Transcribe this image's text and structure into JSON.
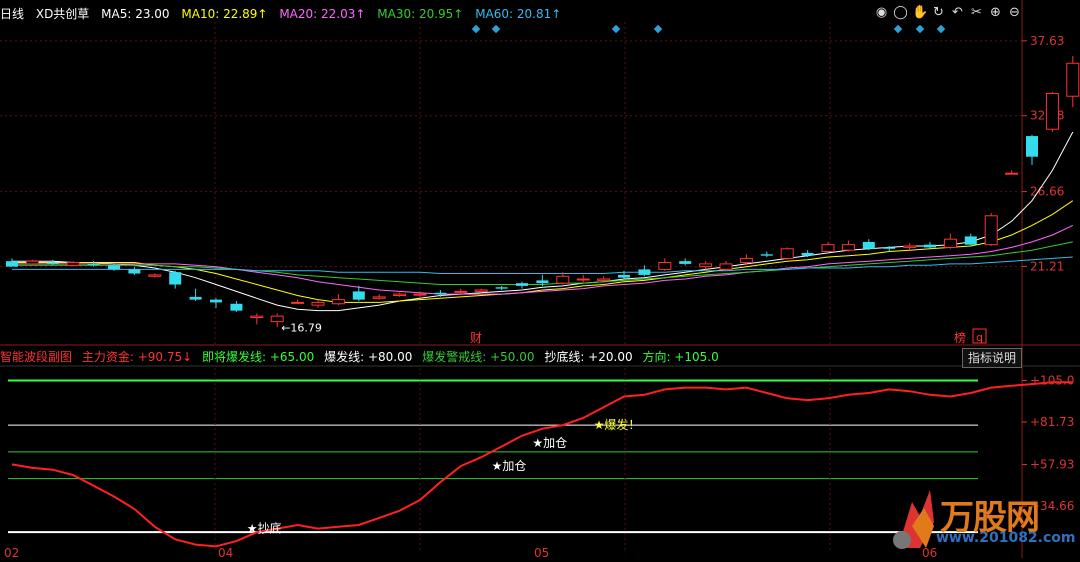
{
  "header": {
    "period": "日线",
    "stock_name": "XD共创草",
    "ma5": "MA5: 23.00",
    "ma10": "MA10: 22.89↑",
    "ma20": "MA20: 22.03↑",
    "ma30": "MA30: 20.95↑",
    "ma60": "MA60: 20.81↑",
    "colors": {
      "ma5": "#ffffff",
      "ma10": "#ffff00",
      "ma20": "#ff66ff",
      "ma30": "#33cc33",
      "ma60": "#33bbee"
    }
  },
  "indicator_header": {
    "name": "智能波段副图",
    "main_fund": "主力资金: +90.75↓",
    "about_to_burst": "即将爆发线: +65.00",
    "burst": "爆发线: +80.00",
    "burst_warning": "爆发警戒线: +50.00",
    "bottom": "抄底线: +20.00",
    "direction": "方向: +105.0",
    "explain_button": "指标说明"
  },
  "toolbar_icons": [
    "eye-icon",
    "circle-icon",
    "hand-icon",
    "refresh-icon",
    "undo-icon",
    "scissors-icon",
    "add-icon",
    "collapse-icon"
  ],
  "price_axis": {
    "labels": [
      "37.63",
      "32.18",
      "26.66",
      "21.21"
    ],
    "values": [
      37.63,
      32.18,
      26.66,
      21.21
    ]
  },
  "indicator_axis": {
    "labels": [
      "+105.0",
      "+81.73",
      "+57.93",
      "+34.66"
    ],
    "values": [
      105.0,
      81.73,
      57.93,
      34.66
    ]
  },
  "x_axis_labels": [
    "02",
    "04",
    "05",
    "06"
  ],
  "annotations": {
    "low_price": "16.79",
    "high_price": "36.53",
    "fin_marker": "财",
    "rank_marker": "榜",
    "q_marker": "q"
  },
  "signals": [
    {
      "label": "★抄底",
      "color": "#ffffff",
      "index": 12,
      "value": 22
    },
    {
      "label": "★加仓",
      "color": "#ffffff",
      "index": 24,
      "value": 57
    },
    {
      "label": "★加仓",
      "color": "#ffffff",
      "index": 26,
      "value": 70
    },
    {
      "label": "★爆发！",
      "color": "#ffff33",
      "index": 29,
      "value": 80
    }
  ],
  "chart_data": {
    "type": "candlestick",
    "candles": [
      [
        21.6,
        21.2,
        21.8,
        21.3
      ],
      [
        21.4,
        21.6,
        21.7,
        21.3
      ],
      [
        21.5,
        21.4,
        21.7,
        21.3
      ],
      [
        21.3,
        21.5,
        21.6,
        21.2
      ],
      [
        21.4,
        21.3,
        21.6,
        21.2
      ],
      [
        21.3,
        21.0,
        21.4,
        20.9
      ],
      [
        21.0,
        20.7,
        21.2,
        20.6
      ],
      [
        20.5,
        20.6,
        20.7,
        20.4
      ],
      [
        20.8,
        19.9,
        20.9,
        19.6
      ],
      [
        19.0,
        18.8,
        19.6,
        18.7
      ],
      [
        18.8,
        18.6,
        18.9,
        18.2
      ],
      [
        18.5,
        18.0,
        18.7,
        17.9
      ],
      [
        17.5,
        17.6,
        17.8,
        17.0
      ],
      [
        17.2,
        17.6,
        17.8,
        16.79
      ],
      [
        18.6,
        18.6,
        18.8,
        18.5
      ],
      [
        18.4,
        18.6,
        18.8,
        18.2
      ],
      [
        18.5,
        18.8,
        19.2,
        18.4
      ],
      [
        19.4,
        18.8,
        19.8,
        18.7
      ],
      [
        18.9,
        19.0,
        19.2,
        18.8
      ],
      [
        19.1,
        19.2,
        19.3,
        19.0
      ],
      [
        19.2,
        19.2,
        19.4,
        19.0
      ],
      [
        19.3,
        19.2,
        19.5,
        19.0
      ],
      [
        19.4,
        19.4,
        19.6,
        19.2
      ],
      [
        19.4,
        19.5,
        19.6,
        19.3
      ],
      [
        19.7,
        19.6,
        19.8,
        19.5
      ],
      [
        20.0,
        19.8,
        20.1,
        19.6
      ],
      [
        20.2,
        20.0,
        20.6,
        19.8
      ],
      [
        20.0,
        20.5,
        20.8,
        19.9
      ],
      [
        20.3,
        20.3,
        20.6,
        20.1
      ],
      [
        20.2,
        20.3,
        20.5,
        20.1
      ],
      [
        20.6,
        20.4,
        20.9,
        20.3
      ],
      [
        21.0,
        20.6,
        21.3,
        20.5
      ],
      [
        21.0,
        21.5,
        21.8,
        20.9
      ],
      [
        21.6,
        21.4,
        21.8,
        21.3
      ],
      [
        21.2,
        21.4,
        21.6,
        21.0
      ],
      [
        21.0,
        21.4,
        21.6,
        20.9
      ],
      [
        21.5,
        21.8,
        22.1,
        21.4
      ],
      [
        22.1,
        22.0,
        22.3,
        21.9
      ],
      [
        21.8,
        22.5,
        22.6,
        21.7
      ],
      [
        22.2,
        22.0,
        22.4,
        21.9
      ],
      [
        22.3,
        22.8,
        23.0,
        22.2
      ],
      [
        22.4,
        22.8,
        23.1,
        22.3
      ],
      [
        23.0,
        22.5,
        23.2,
        22.4
      ],
      [
        22.6,
        22.5,
        22.7,
        22.3
      ],
      [
        22.6,
        22.7,
        22.9,
        22.4
      ],
      [
        22.8,
        22.6,
        23.0,
        22.5
      ],
      [
        22.6,
        23.2,
        23.6,
        22.5
      ],
      [
        23.4,
        22.8,
        23.6,
        22.7
      ],
      [
        22.8,
        24.9,
        25.1,
        22.7
      ],
      [
        28.0,
        28.0,
        28.2,
        27.9
      ],
      [
        30.7,
        29.2,
        30.8,
        28.6
      ],
      [
        31.2,
        33.8,
        33.9,
        31.0
      ],
      [
        33.6,
        36.0,
        36.53,
        32.8
      ]
    ],
    "ma_lines": {
      "MA5": [
        21.6,
        21.6,
        21.6,
        21.5,
        21.5,
        21.4,
        21.3,
        21.1,
        20.8,
        20.4,
        19.9,
        19.4,
        18.9,
        18.4,
        18.1,
        18.0,
        18.0,
        18.2,
        18.4,
        18.7,
        18.9,
        19.1,
        19.2,
        19.3,
        19.4,
        19.5,
        19.7,
        19.8,
        20.0,
        20.1,
        20.3,
        20.4,
        20.6,
        20.8,
        21.0,
        21.2,
        21.4,
        21.6,
        21.8,
        22.0,
        22.2,
        22.4,
        22.5,
        22.6,
        22.7,
        22.7,
        22.8,
        23.0,
        23.5,
        24.5,
        26.0,
        28.2,
        31.0
      ],
      "MA10": [
        21.5,
        21.5,
        21.5,
        21.5,
        21.5,
        21.5,
        21.5,
        21.3,
        21.2,
        21.0,
        20.7,
        20.3,
        19.9,
        19.5,
        19.1,
        18.8,
        18.6,
        18.6,
        18.6,
        18.7,
        18.8,
        18.9,
        19.0,
        19.1,
        19.2,
        19.3,
        19.5,
        19.6,
        19.8,
        19.9,
        20.1,
        20.2,
        20.4,
        20.6,
        20.8,
        21.0,
        21.2,
        21.4,
        21.6,
        21.7,
        21.9,
        22.0,
        22.1,
        22.3,
        22.4,
        22.5,
        22.6,
        22.7,
        23.0,
        23.5,
        24.2,
        25.0,
        26.0
      ],
      "MA20": [
        21.4,
        21.4,
        21.4,
        21.4,
        21.4,
        21.4,
        21.4,
        21.4,
        21.4,
        21.3,
        21.2,
        21.0,
        20.8,
        20.6,
        20.4,
        20.1,
        19.9,
        19.7,
        19.5,
        19.4,
        19.3,
        19.2,
        19.2,
        19.2,
        19.2,
        19.3,
        19.4,
        19.5,
        19.6,
        19.8,
        19.9,
        20.0,
        20.2,
        20.3,
        20.5,
        20.6,
        20.8,
        20.9,
        21.1,
        21.2,
        21.4,
        21.5,
        21.6,
        21.7,
        21.8,
        21.9,
        22.0,
        22.1,
        22.3,
        22.6,
        23.0,
        23.5,
        24.2
      ],
      "MA30": [
        21.3,
        21.3,
        21.3,
        21.3,
        21.3,
        21.3,
        21.3,
        21.3,
        21.2,
        21.2,
        21.1,
        21.0,
        20.9,
        20.8,
        20.6,
        20.5,
        20.4,
        20.3,
        20.2,
        20.1,
        20.0,
        19.9,
        19.9,
        19.9,
        19.9,
        19.9,
        19.9,
        20.0,
        20.0,
        20.1,
        20.2,
        20.3,
        20.4,
        20.5,
        20.6,
        20.7,
        20.8,
        20.9,
        21.0,
        21.1,
        21.2,
        21.3,
        21.4,
        21.5,
        21.6,
        21.7,
        21.8,
        21.9,
        22.0,
        22.2,
        22.4,
        22.7,
        23.0
      ],
      "MA60": [
        21.0,
        21.0,
        21.0,
        21.0,
        21.0,
        21.0,
        21.0,
        21.0,
        21.0,
        21.0,
        21.0,
        21.0,
        20.9,
        20.9,
        20.9,
        20.9,
        20.8,
        20.8,
        20.8,
        20.8,
        20.8,
        20.7,
        20.7,
        20.7,
        20.7,
        20.7,
        20.7,
        20.7,
        20.7,
        20.7,
        20.8,
        20.8,
        20.8,
        20.9,
        20.9,
        20.9,
        21.0,
        21.0,
        21.0,
        21.1,
        21.1,
        21.1,
        21.2,
        21.2,
        21.3,
        21.3,
        21.4,
        21.4,
        21.5,
        21.6,
        21.7,
        21.8,
        21.9
      ]
    },
    "indicator": {
      "name": "主力资金",
      "values": [
        58,
        56,
        55,
        52,
        46,
        40,
        33,
        23,
        16,
        13,
        12,
        15,
        20,
        22,
        24,
        22,
        23,
        24,
        28,
        32,
        38,
        48,
        57,
        62,
        68,
        74,
        78,
        80,
        84,
        90,
        96,
        97,
        100,
        101,
        101,
        100,
        101,
        98,
        95,
        94,
        95,
        97,
        98,
        100,
        99,
        97,
        96,
        98,
        101,
        102,
        103,
        104,
        104
      ],
      "levels": [
        {
          "name": "方向",
          "value": 105.0,
          "color": "#33ff33"
        },
        {
          "name": "爆发线",
          "value": 80.0,
          "color": "#ffffff"
        },
        {
          "name": "即将爆发线",
          "value": 65.0,
          "color": "#33cc33"
        },
        {
          "name": "爆发警戒线",
          "value": 50.0,
          "color": "#33cc33"
        },
        {
          "name": "抄底线",
          "value": 20.0,
          "color": "#ffffff"
        }
      ]
    },
    "price_ylim": [
      15.5,
      39.0
    ],
    "indicator_ylim": [
      10,
      112
    ]
  },
  "logo": {
    "name": "万股网",
    "url": "www.201082.com"
  }
}
